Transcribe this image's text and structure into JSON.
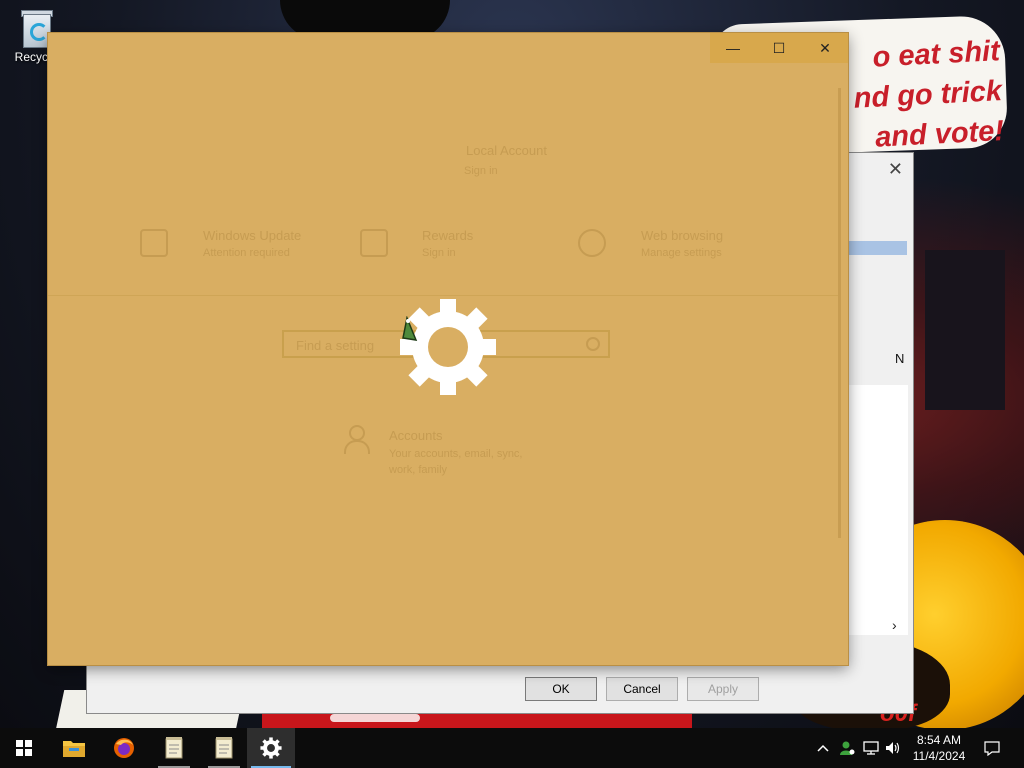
{
  "desktop": {
    "recycle_bin_label": "Recycle",
    "wallpaper_text_lines": [
      "o eat shit",
      "nd go trick",
      "and vote!"
    ],
    "wallpaper_corner_text": "o0f"
  },
  "background_dialog": {
    "side_letter": "N",
    "scroll_arrow": "›",
    "buttons": {
      "ok": "OK",
      "cancel": "Cancel",
      "apply": "Apply"
    }
  },
  "settings_window": {
    "caption": {
      "minimize": "—",
      "maximize": "☐",
      "close": "✕"
    },
    "account": {
      "title": "Local Account",
      "subtitle": "Sign in"
    },
    "quick_links": [
      {
        "title": "Windows Update",
        "subtitle": "Attention required"
      },
      {
        "title": "Rewards",
        "subtitle": "Sign in"
      },
      {
        "title": "Web browsing",
        "subtitle": "Manage settings"
      }
    ],
    "search_placeholder": "Find a setting",
    "category": {
      "title": "Accounts",
      "subtitle_line1": "Your accounts, email, sync,",
      "subtitle_line2": "work, family"
    },
    "splash_color": "#d9ae62"
  },
  "taskbar": {
    "clock": {
      "time": "8:54 AM",
      "date": "11/4/2024"
    },
    "tray_chevron": "^"
  }
}
